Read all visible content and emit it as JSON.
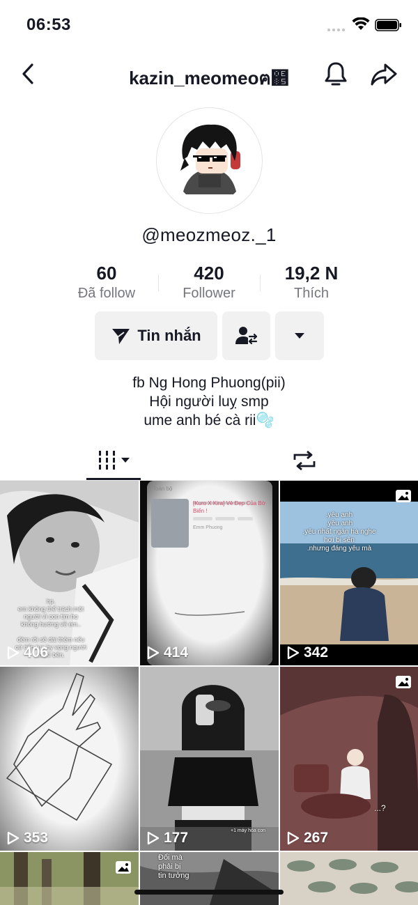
{
  "status_bar": {
    "time": "06:53"
  },
  "nav": {
    "title": "kazin_meomeoฅ຅"
  },
  "profile": {
    "handle": "@meozmeoz._1",
    "stats": [
      {
        "value": "60",
        "label": "Đã follow"
      },
      {
        "value": "420",
        "label": "Follower"
      },
      {
        "value": "19,2 N",
        "label": "Thích"
      }
    ],
    "message_button": "Tin nhắn",
    "bio_lines": [
      "fb Ng Hong Phuong(pii)",
      "Hội người luỵ smp",
      "ume anh bé cà rii🫧"
    ]
  },
  "tabs": {
    "videos_icon": "grid-icon",
    "reposts_icon": "repost-icon"
  },
  "grid": {
    "items": [
      {
        "views": "406",
        "caption": "hp.\nem không thể trách một\nngười vì con tim họ\nkhông hướng về em..\n\nđêm rồi sẽ dài thêm nếu\ncứ tiếp tục hy vọng người\nta kề bên."
      },
      {
        "views": "414",
        "caption_title": "[Kuro X Kira] Vẻ Đẹp Của Bờ Biển !",
        "caption_tab": "Toàn bộ",
        "caption_artist": "Emm Phuong"
      },
      {
        "views": "342",
        "caption": ".yêu anh\n.yêu anh\n.yêu nhất ngân hà nghe\nhơi bị sên\n.nhưng đáng yêu mà",
        "photo": true
      },
      {
        "views": "353"
      },
      {
        "views": "177",
        "caption": "+1 máy hóa con"
      },
      {
        "views": "267",
        "caption": "...?",
        "photo": true
      },
      {
        "photo": true
      },
      {
        "caption": "Đổi mà\nphải bị\ntin tưởng"
      },
      {}
    ]
  },
  "colors": {
    "text": "#161823",
    "secondary": "#75767e",
    "button_bg": "#f1f1f2"
  }
}
